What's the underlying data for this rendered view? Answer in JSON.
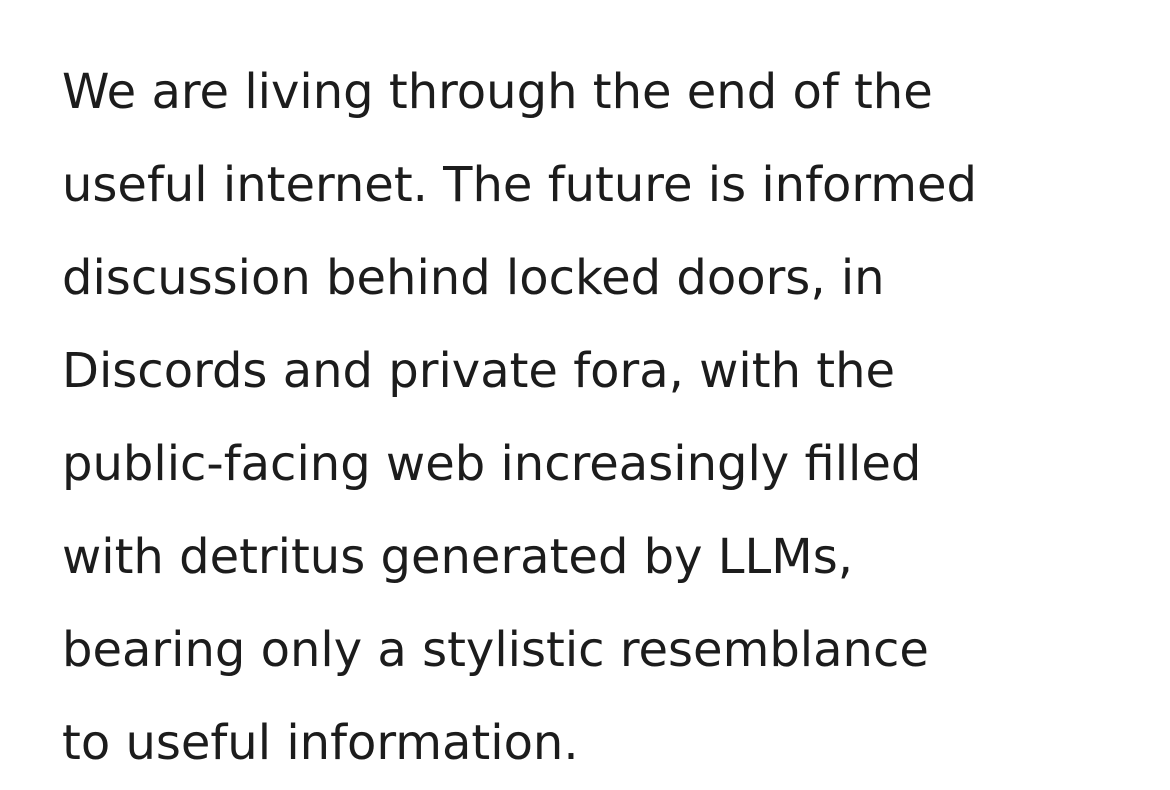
{
  "paragraph": {
    "lines": [
      "We are living through the end of the",
      "useful internet. The future is informed",
      "discussion behind locked doors, in",
      "Discords and private fora, with the",
      "public-facing web increasingly filled",
      "with detritus generated by LLMs,",
      "bearing only a stylistic resemblance",
      "to useful information."
    ]
  }
}
